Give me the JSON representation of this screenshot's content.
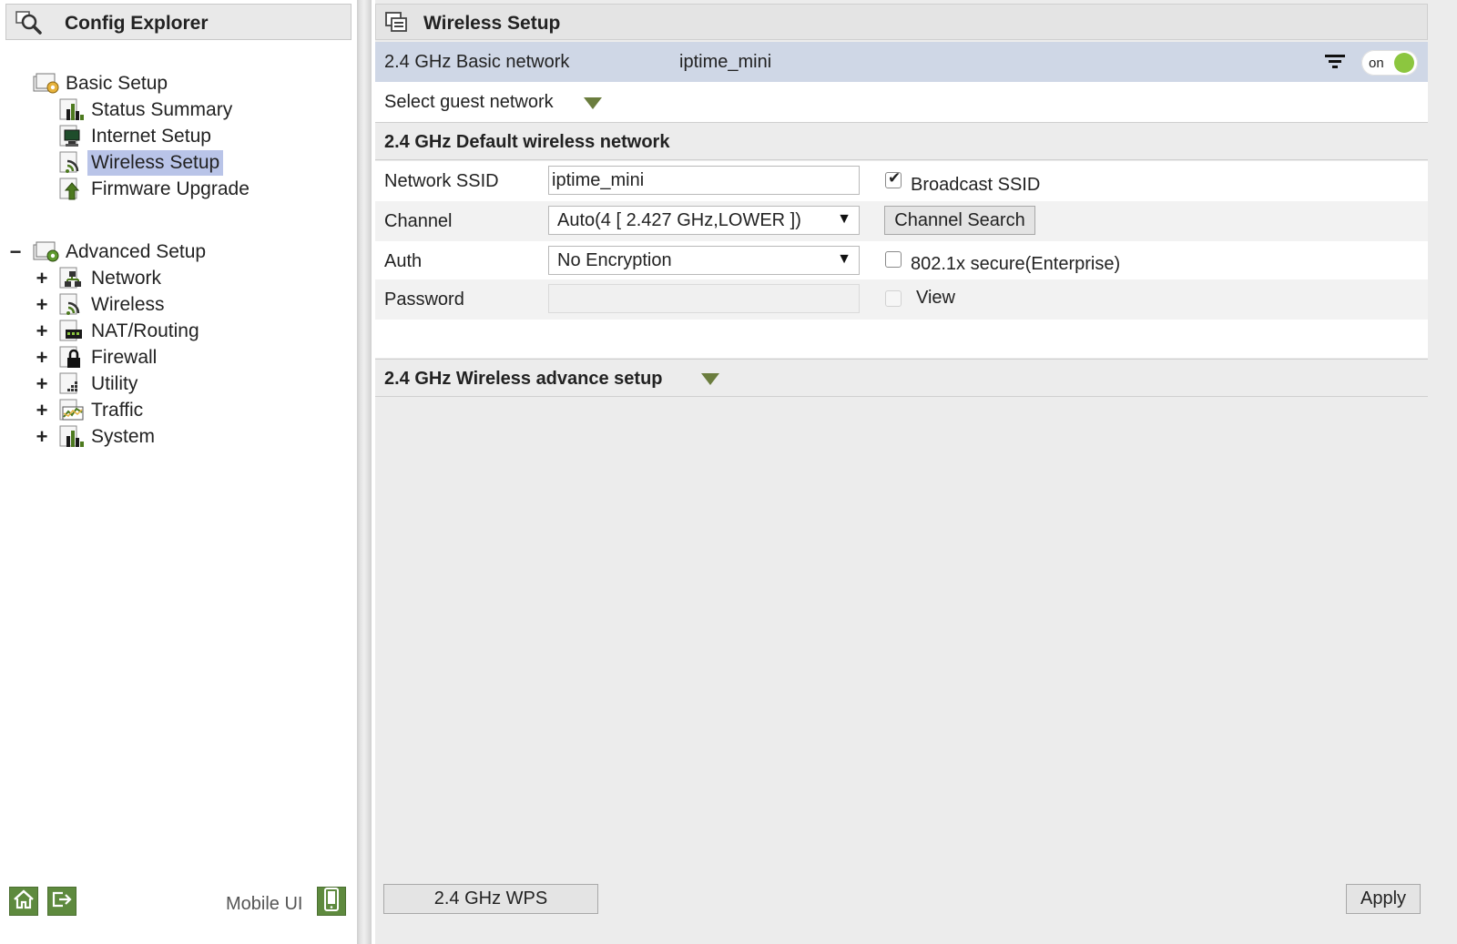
{
  "sidebar": {
    "title": "Config Explorer",
    "basic": {
      "label": "Basic Setup",
      "items": [
        {
          "label": "Status Summary"
        },
        {
          "label": "Internet Setup"
        },
        {
          "label": "Wireless Setup"
        },
        {
          "label": "Firmware Upgrade"
        }
      ]
    },
    "advanced": {
      "collapse_symbol": "−",
      "label": "Advanced Setup",
      "expand_symbol": "+",
      "items": [
        {
          "label": "Network"
        },
        {
          "label": "Wireless"
        },
        {
          "label": "NAT/Routing"
        },
        {
          "label": "Firewall"
        },
        {
          "label": "Utility"
        },
        {
          "label": "Traffic"
        },
        {
          "label": "System"
        }
      ]
    },
    "footer": {
      "mobile_label": "Mobile UI"
    }
  },
  "main": {
    "title": "Wireless Setup",
    "basic_network": {
      "label": "2.4 GHz Basic network",
      "ssid": "iptime_mini",
      "toggle_label": "on",
      "toggle_state": true
    },
    "guest": {
      "label": "Select guest network"
    },
    "default_section": {
      "title": "2.4 GHz Default wireless network"
    },
    "form": {
      "ssid_label": "Network SSID",
      "ssid_value": "iptime_mini",
      "broadcast_label": "Broadcast SSID",
      "broadcast_checked": true,
      "channel_label": "Channel",
      "channel_value": "Auto(4 [ 2.427 GHz,LOWER ])",
      "channel_search_label": "Channel Search",
      "auth_label": "Auth",
      "auth_value": "No Encryption",
      "enterprise_label": "802.1x secure(Enterprise)",
      "enterprise_checked": false,
      "password_label": "Password",
      "password_value": "",
      "view_label": "View",
      "view_checked": false
    },
    "advance_section": {
      "title": "2.4 GHz Wireless advance setup"
    },
    "buttons": {
      "wps_label": "2.4 GHz WPS",
      "apply_label": "Apply"
    }
  },
  "colors": {
    "selection": "#b9c4e8",
    "basic_bar": "#cfd7e6",
    "toggle_knob": "#8cc63f",
    "accent_green": "#5e8a3e",
    "triangle": "#6b7d3e"
  }
}
